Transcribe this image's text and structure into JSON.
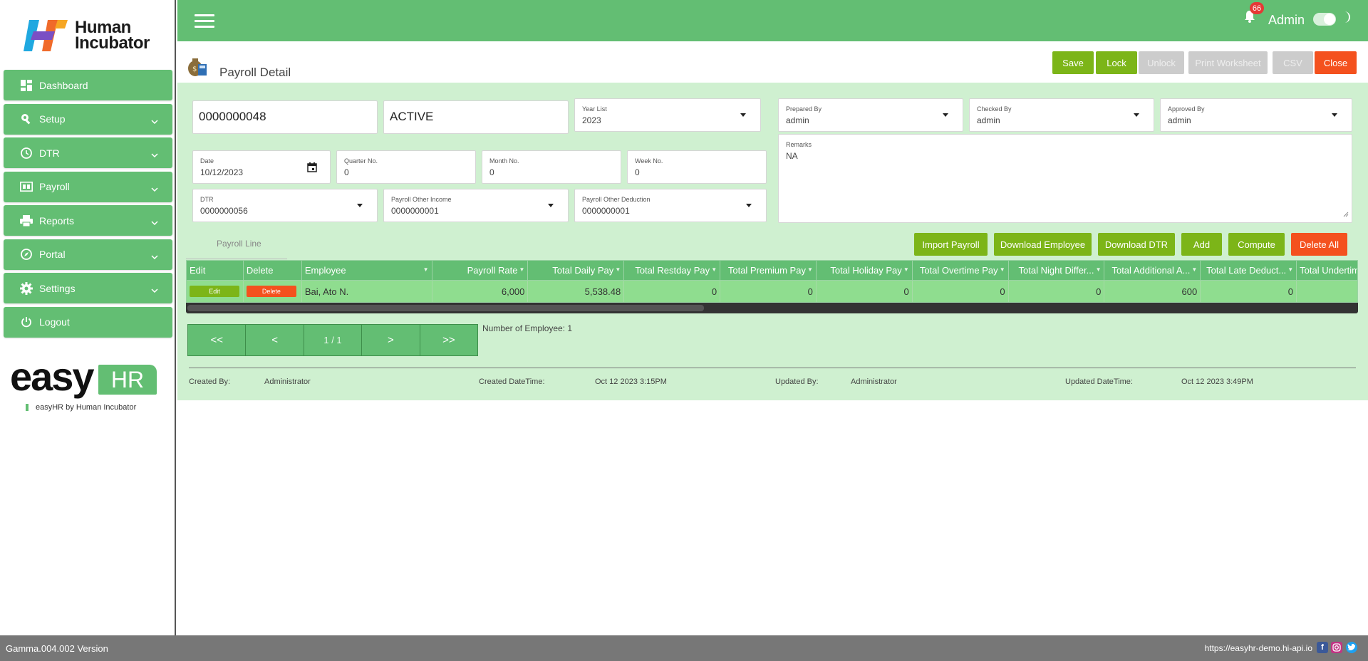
{
  "brand": {
    "name_line1": "Human",
    "name_line2": "Incubator",
    "easy_word": "easy",
    "hr_word": "HR",
    "easy_sub": "easyHR by Human Incubator"
  },
  "sidebar": {
    "items": [
      {
        "label": "Dashboard",
        "icon": "dashboard-icon"
      },
      {
        "label": "Setup",
        "icon": "wrench-icon"
      },
      {
        "label": "DTR",
        "icon": "clock-icon"
      },
      {
        "label": "Payroll",
        "icon": "payroll-icon"
      },
      {
        "label": "Reports",
        "icon": "printer-icon"
      },
      {
        "label": "Portal",
        "icon": "portal-icon"
      },
      {
        "label": "Settings",
        "icon": "gear-icon"
      },
      {
        "label": "Logout",
        "icon": "power-icon"
      }
    ]
  },
  "topbar": {
    "notification_count": "66",
    "user": "Admin"
  },
  "header": {
    "title": "Payroll Detail",
    "buttons": {
      "save": "Save",
      "lock": "Lock",
      "unlock": "Unlock",
      "print": "Print Worksheet",
      "csv": "CSV",
      "close": "Close"
    }
  },
  "form": {
    "payroll_no": "0000000048",
    "status": "ACTIVE",
    "year_list": {
      "label": "Year List",
      "value": "2023"
    },
    "prepared_by": {
      "label": "Prepared By",
      "value": "admin"
    },
    "checked_by": {
      "label": "Checked By",
      "value": "admin"
    },
    "approved_by": {
      "label": "Approved By",
      "value": "admin"
    },
    "date": {
      "label": "Date",
      "value": "10/12/2023"
    },
    "quarter": {
      "label": "Quarter No.",
      "value": "0"
    },
    "month": {
      "label": "Month No.",
      "value": "0"
    },
    "week": {
      "label": "Week No.",
      "value": "0"
    },
    "remarks": {
      "label": "Remarks",
      "value": "NA"
    },
    "dtr": {
      "label": "DTR",
      "value": "0000000056"
    },
    "other_income": {
      "label": "Payroll Other Income",
      "value": "0000000001"
    },
    "other_deduction": {
      "label": "Payroll Other Deduction",
      "value": "0000000001"
    }
  },
  "lines": {
    "tab": "Payroll Line",
    "buttons": {
      "import": "Import Payroll",
      "download_employee": "Download Employee",
      "download_dtr": "Download DTR",
      "add": "Add",
      "compute": "Compute",
      "delete_all": "Delete All"
    },
    "columns": [
      "Edit",
      "Delete",
      "Employee",
      "Payroll Rate",
      "Total Daily Pay",
      "Total Restday Pay",
      "Total Premium Pay",
      "Total Holiday Pay",
      "Total Overtime Pay",
      "Total Night Differ...",
      "Total Additional A...",
      "Total Late Deduct...",
      "Total Undertim"
    ],
    "row": {
      "edit": "Edit",
      "delete": "Delete",
      "employee": "Bai, Ato N.",
      "payroll_rate": "6,000",
      "daily": "5,538.48",
      "restday": "0",
      "premium": "0",
      "holiday": "0",
      "overtime": "0",
      "night": "0",
      "additional": "600",
      "late": "0"
    }
  },
  "pager": {
    "first": "<<",
    "prev": "<",
    "page": "1 / 1",
    "next": ">",
    "last": ">>",
    "count": "Number of Employee: 1"
  },
  "meta": {
    "created_by_label": "Created By:",
    "created_by": "Administrator",
    "created_dt_label": "Created DateTime:",
    "created_dt": "Oct 12 2023 3:15PM",
    "updated_by_label": "Updated By:",
    "updated_by": "Administrator",
    "updated_dt_label": "Updated DateTime:",
    "updated_dt": "Oct 12 2023 3:49PM"
  },
  "footer": {
    "version": "Gamma.004.002 Version",
    "site": "https://easyhr-demo.hi-api.io"
  },
  "colors": {
    "primary": "#63be73",
    "panel": "#cff0d0",
    "action": "#7cb518",
    "danger": "#f4511e",
    "row": "#8fdd8f"
  }
}
